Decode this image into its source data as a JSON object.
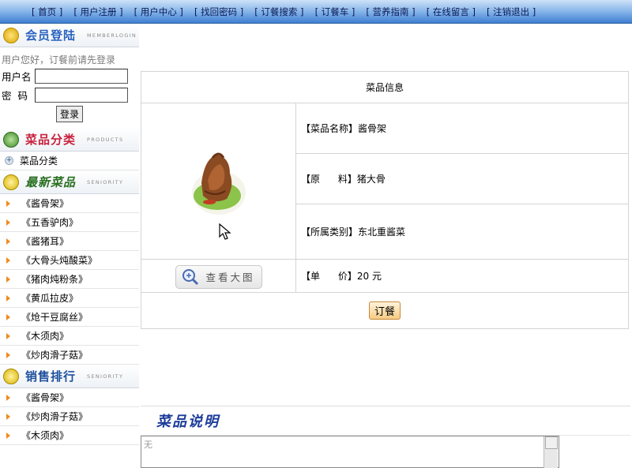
{
  "nav": {
    "items": [
      "首页",
      "用户注册",
      "用户中心",
      "找回密码",
      "订餐搜索",
      "订餐车",
      "营养指南",
      "在线留言",
      "注销退出"
    ]
  },
  "login": {
    "title": "会员登陆",
    "subtitle": "MEMBERLOGIN",
    "hint": "用户您好，订餐前请先登录",
    "username_label": "用户名",
    "password_label": "密  码",
    "button": "登录"
  },
  "categories": {
    "title": "菜品分类",
    "subtitle": "PRODUCTS",
    "item": "菜品分类"
  },
  "newest": {
    "title": "最新菜品",
    "subtitle": "SENIORITY",
    "items": [
      "《酱骨架》",
      "《五香驴肉》",
      "《酱猪耳》",
      "《大骨头炖酸菜》",
      "《猪肉炖粉条》",
      "《黄瓜拉皮》",
      "《炝干豆腐丝》",
      "《木须肉》",
      "《炒肉滑子菇》"
    ]
  },
  "ranking": {
    "title": "销售排行",
    "subtitle": "SENIORITY",
    "items": [
      "《酱骨架》",
      "《炒肉滑子菇》",
      "《木须肉》"
    ]
  },
  "dish": {
    "header": "菜品信息",
    "name_label": "【菜品名称】",
    "name": "酱骨架",
    "material_label": "【原      料】",
    "material": "猪大骨",
    "category_label": "【所属类别】",
    "category": "东北重酱菜",
    "price_label": "【单      价】",
    "price": "20 元",
    "zoom_button": "查看大图",
    "order_button": "订餐"
  },
  "description": {
    "title": "菜品说明",
    "text": "无"
  },
  "colors": {
    "nav_gradient_top": "#cfe2f8",
    "nav_gradient_bottom": "#3f7fcf",
    "login_title": "#2a63c0",
    "category_title": "#c8233e",
    "newest_title": "#2a6f22",
    "ranking_title": "#1e4f9c",
    "list_arrow": "#f08a1c"
  }
}
